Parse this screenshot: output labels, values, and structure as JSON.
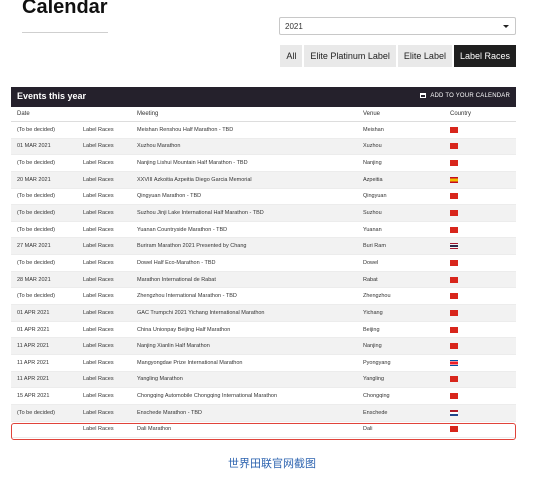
{
  "page": {
    "title": "Calendar",
    "caption": "世界田联官网截图"
  },
  "year_select": {
    "value": "2021"
  },
  "filters": [
    {
      "label": "All",
      "active": false
    },
    {
      "label": "Elite Platinum Label",
      "active": false
    },
    {
      "label": "Elite Label",
      "active": false
    },
    {
      "label": "Label Races",
      "active": true
    }
  ],
  "events": {
    "title": "Events this year",
    "add_calendar": "ADD TO YOUR CALENDAR",
    "columns": {
      "date": "Date",
      "category": "",
      "meeting": "Meeting",
      "venue": "Venue",
      "country": "Country"
    },
    "rows": [
      {
        "date": "(To be decided)",
        "category": "Label Races",
        "meeting": "Meishan Renshou Half Marathon - TBD",
        "venue": "Meishan",
        "flag": "cn"
      },
      {
        "date": "01 MAR 2021",
        "category": "Label Races",
        "meeting": "Xuzhou Marathon",
        "venue": "Xuzhou",
        "flag": "cn"
      },
      {
        "date": "(To be decided)",
        "category": "Label Races",
        "meeting": "Nanjing Lishui Mountain Half Marathon - TBD",
        "venue": "Nanjing",
        "flag": "cn"
      },
      {
        "date": "20 MAR 2021",
        "category": "Label Races",
        "meeting": "XXVIII Azkoitia Azpeitia Diego Garcia Memorial",
        "venue": "Azpeitia",
        "flag": "es"
      },
      {
        "date": "(To be decided)",
        "category": "Label Races",
        "meeting": "Qingyuan Marathon - TBD",
        "venue": "Qingyuan",
        "flag": "cn"
      },
      {
        "date": "(To be decided)",
        "category": "Label Races",
        "meeting": "Suzhou Jinji Lake International Half Marathon - TBD",
        "venue": "Suzhou",
        "flag": "cn"
      },
      {
        "date": "(To be decided)",
        "category": "Label Races",
        "meeting": "Yuanan Countryside Marathon - TBD",
        "venue": "Yuanan",
        "flag": "cn"
      },
      {
        "date": "27 MAR 2021",
        "category": "Label Races",
        "meeting": "Buriram Marathon 2021 Presented by Chang",
        "venue": "Buri Ram",
        "flag": "th"
      },
      {
        "date": "(To be decided)",
        "category": "Label Races",
        "meeting": "Dowel Half Eco-Marathon - TBD",
        "venue": "Dowel",
        "flag": "cn"
      },
      {
        "date": "28 MAR 2021",
        "category": "Label Races",
        "meeting": "Marathon International de Rabat",
        "venue": "Rabat",
        "flag": "cn"
      },
      {
        "date": "(To be decided)",
        "category": "Label Races",
        "meeting": "Zhengzhou International Marathon - TBD",
        "venue": "Zhengzhou",
        "flag": "cn"
      },
      {
        "date": "01 APR 2021",
        "category": "Label Races",
        "meeting": "GAC Trumpchi 2021 Yichang International Marathon",
        "venue": "Yichang",
        "flag": "cn"
      },
      {
        "date": "01 APR 2021",
        "category": "Label Races",
        "meeting": "China Unionpay Beijing Half Marathon",
        "venue": "Beijing",
        "flag": "cn"
      },
      {
        "date": "11 APR 2021",
        "category": "Label Races",
        "meeting": "Nanjing Xianlin Half Marathon",
        "venue": "Nanjing",
        "flag": "cn"
      },
      {
        "date": "11 APR 2021",
        "category": "Label Races",
        "meeting": "Mangyongdae Prize International Marathon",
        "venue": "Pyongyang",
        "flag": "kp"
      },
      {
        "date": "11 APR 2021",
        "category": "Label Races",
        "meeting": "Yangling Marathon",
        "venue": "Yangling",
        "flag": "cn"
      },
      {
        "date": "15 APR 2021",
        "category": "Label Races",
        "meeting": "Chongqing Automobile Chongqing International Marathon",
        "venue": "Chongqing",
        "flag": "cn"
      },
      {
        "date": "(To be decided)",
        "category": "Label Races",
        "meeting": "Enschede Marathon - TBD",
        "venue": "Enschede",
        "flag": "nl"
      },
      {
        "date": "",
        "category": "Label Races",
        "meeting": "Dali Marathon",
        "venue": "Dali",
        "flag": "cn"
      }
    ]
  }
}
